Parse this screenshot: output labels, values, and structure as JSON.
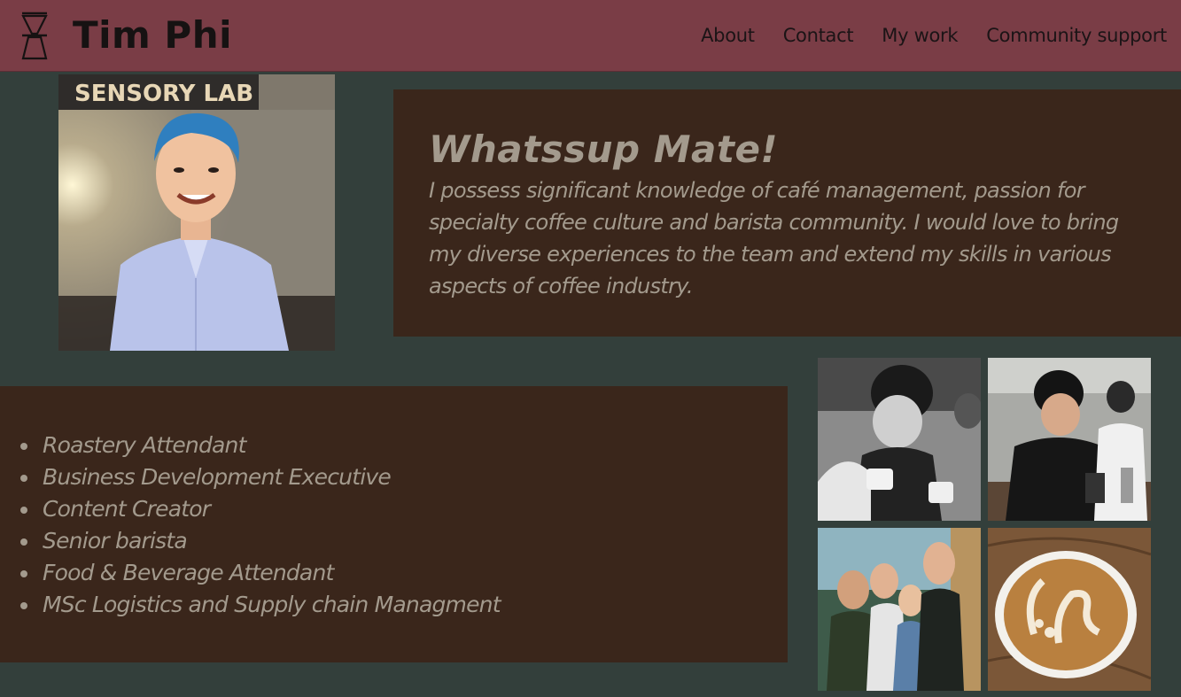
{
  "header": {
    "brand": "Tim Phi",
    "logo_icon": "pour-over-coffee-dripper-icon",
    "nav": [
      "About",
      "Contact",
      "My work",
      "Community support"
    ]
  },
  "portrait": {
    "sign_text": "SENSORY LAB"
  },
  "intro": {
    "greeting": "Whatssup Mate!",
    "bio": "I possess significant knowledge of café management, passion for specialty coffee culture and barista community. I would love to bring my diverse experiences to the team and extend my skills in various aspects of coffee industry."
  },
  "roles": [
    "Roastery Attendant",
    "Business Development Executive",
    "Content Creator",
    "Senior barista",
    "Food & Beverage Attendant",
    "MSc Logistics and Supply chain Managment"
  ],
  "colors": {
    "header_bg": "#7a3d46",
    "page_bg": "#333f3b",
    "card_bg": "#3a261b",
    "card_text": "#a39a8d"
  }
}
